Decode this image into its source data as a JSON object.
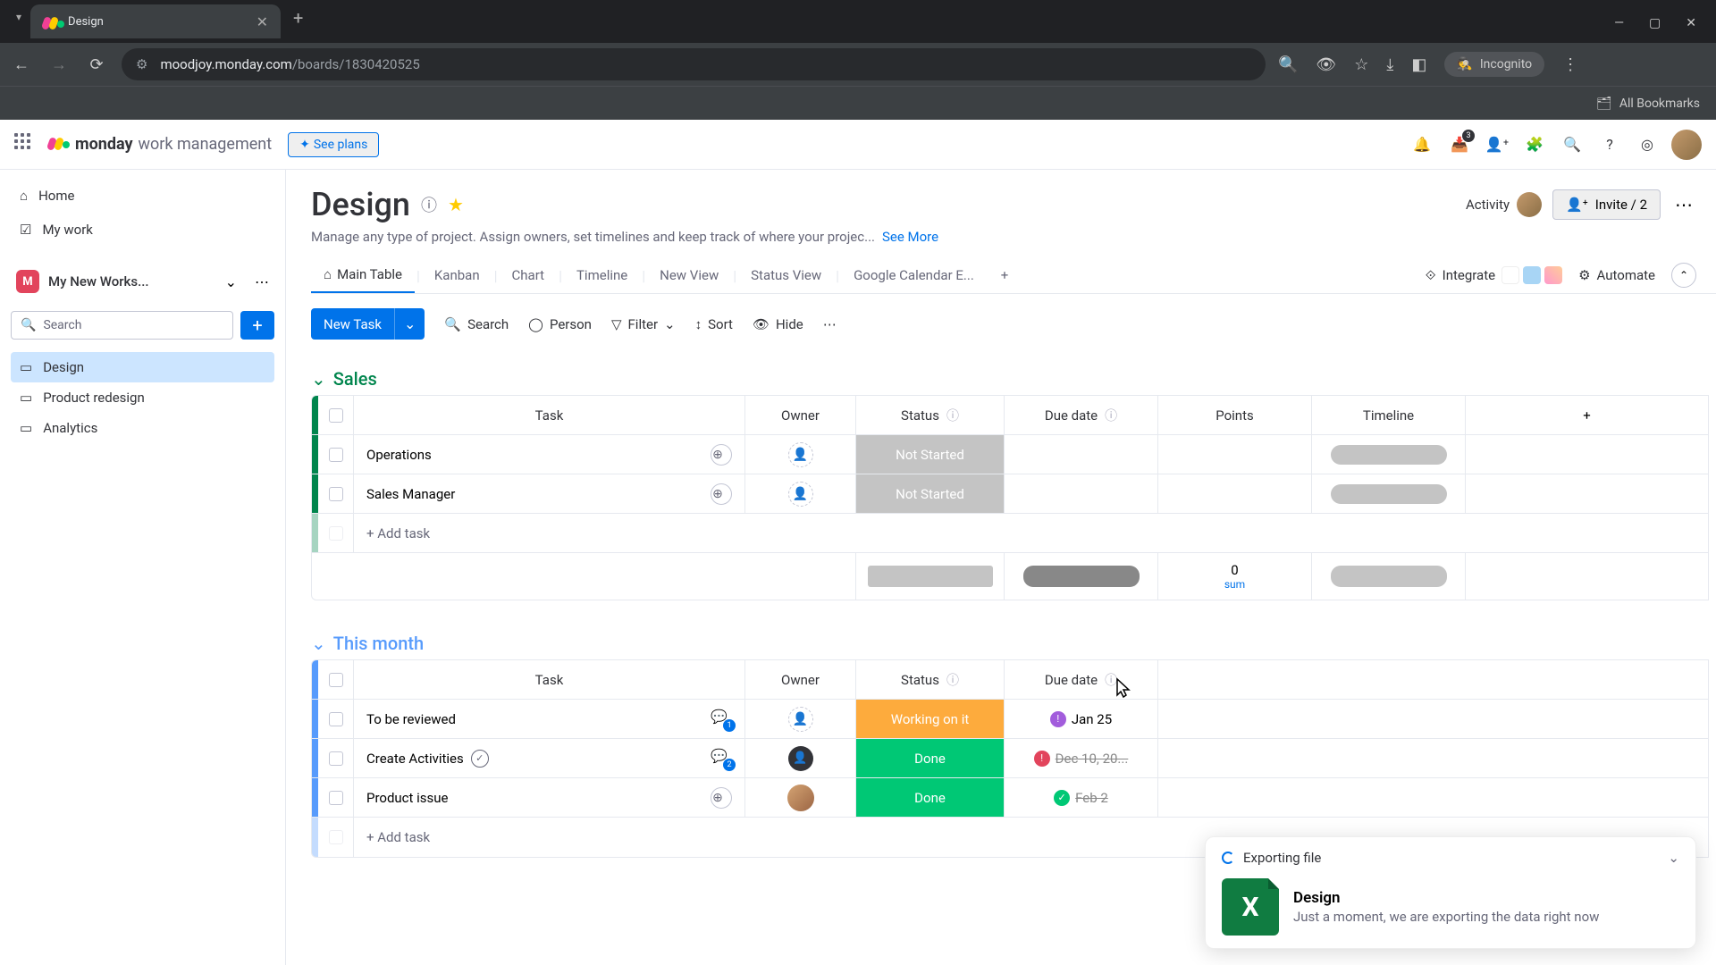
{
  "browser": {
    "tab_title": "Design",
    "url_domain": "moodjoy.monday.com",
    "url_path": "/boards/1830420525",
    "bookmarks": "All Bookmarks",
    "incognito": "Incognito"
  },
  "header": {
    "brand": "monday",
    "product": "work management",
    "see_plans": "See plans",
    "inbox_badge": "3"
  },
  "sidebar": {
    "home": "Home",
    "mywork": "My work",
    "workspace": "My New Works...",
    "search_placeholder": "Search",
    "boards": [
      {
        "name": "Design"
      },
      {
        "name": "Product redesign"
      },
      {
        "name": "Analytics"
      }
    ]
  },
  "board": {
    "title": "Design",
    "description": "Manage any type of project. Assign owners, set timelines and keep track of where your projec...",
    "see_more": "See More",
    "activity": "Activity",
    "invite": "Invite / 2"
  },
  "views": {
    "tabs": [
      "Main Table",
      "Kanban",
      "Chart",
      "Timeline",
      "New View",
      "Status View",
      "Google Calendar E..."
    ],
    "integrate": "Integrate",
    "automate": "Automate"
  },
  "toolbar": {
    "new_task": "New Task",
    "search": "Search",
    "person": "Person",
    "filter": "Filter",
    "sort": "Sort",
    "hide": "Hide"
  },
  "columns": {
    "task": "Task",
    "owner": "Owner",
    "status": "Status",
    "due": "Due date",
    "points": "Points",
    "timeline": "Timeline"
  },
  "groups": [
    {
      "name": "Sales",
      "color": "green",
      "rows": [
        {
          "task": "Operations",
          "status": "Not Started",
          "action": "add"
        },
        {
          "task": "Sales Manager",
          "status": "Not Started",
          "action": "add"
        }
      ],
      "summary_points": "0",
      "summary_label": "sum"
    },
    {
      "name": "This month",
      "color": "blue",
      "rows": [
        {
          "task": "To be reviewed",
          "status": "Working on it",
          "status_class": "working",
          "due": "Jan 25",
          "badge": "purple",
          "chat": "1",
          "action": "none"
        },
        {
          "task": "Create Activities",
          "status": "Done",
          "status_class": "done",
          "due": "Dec 10, 20...",
          "strike": true,
          "badge": "red",
          "chat": "2",
          "owner": "filled",
          "action": "check"
        },
        {
          "task": "Product issue",
          "status": "Done",
          "status_class": "done",
          "due": "Feb 2",
          "strike": true,
          "badge": "green",
          "owner": "photo",
          "action": "add"
        }
      ]
    }
  ],
  "add_task": "+ Add task",
  "toast": {
    "heading": "Exporting file",
    "title": "Design",
    "message": "Just a moment, we are exporting the data right now"
  }
}
